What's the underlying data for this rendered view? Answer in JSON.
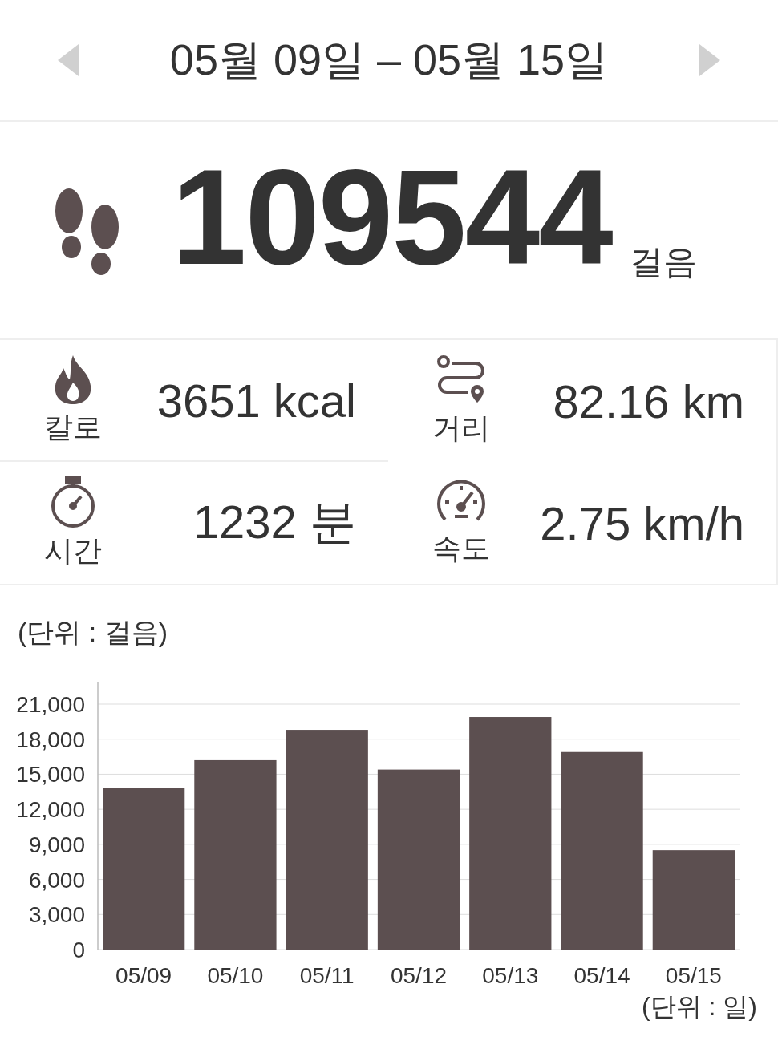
{
  "header": {
    "title": "05월 09일 – 05월 15일"
  },
  "summary": {
    "steps": "109544",
    "unit": "걸음"
  },
  "stats": [
    {
      "kind": "calorie",
      "value": "3651 kcal",
      "label": "칼로"
    },
    {
      "kind": "distance",
      "value": "82.16 km",
      "label": "거리"
    },
    {
      "kind": "time",
      "value": "1232 분",
      "label": "시간"
    },
    {
      "kind": "speed",
      "value": "2.75 km/h",
      "label": "속도"
    }
  ],
  "chart": {
    "unit_label": "(단위 : 걸음)",
    "x_unit_label": "(단위 : 일)",
    "chart_data": {
      "type": "bar",
      "categories": [
        "05/09",
        "05/10",
        "05/11",
        "05/12",
        "05/13",
        "05/14",
        "05/15"
      ],
      "series": [
        {
          "color": "#5c4f50",
          "values": [
            13800,
            16200,
            18800,
            15400,
            19900,
            16900,
            8500
          ]
        }
      ],
      "grid": true,
      "ylim": [
        0,
        21000
      ],
      "yticks": [
        {
          "value": 0,
          "label": "0"
        },
        {
          "value": 3000,
          "label": "3,000"
        },
        {
          "value": 6000,
          "label": "6,000"
        },
        {
          "value": 9000,
          "label": "9,000"
        },
        {
          "value": 12000,
          "label": "12,000"
        },
        {
          "value": 15000,
          "label": "15,000"
        },
        {
          "value": 18000,
          "label": "18,000"
        },
        {
          "value": 21000,
          "label": "21,000"
        }
      ]
    }
  }
}
